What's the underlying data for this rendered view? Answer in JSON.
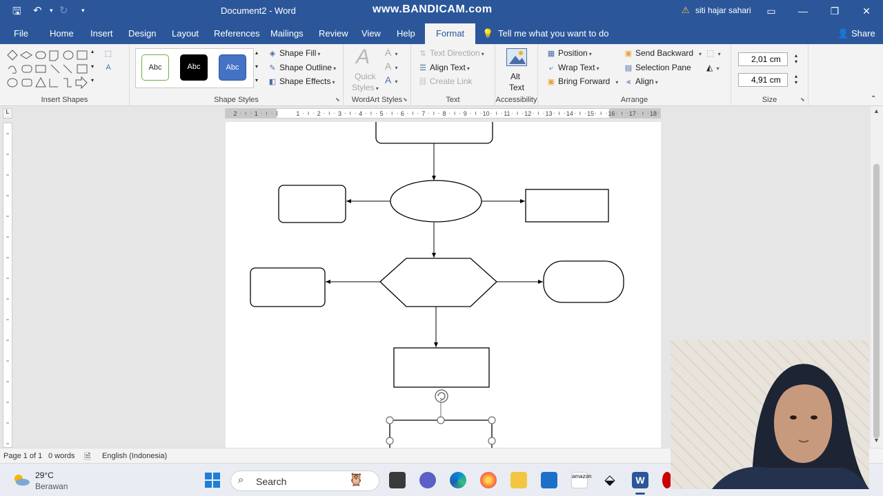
{
  "titlebar": {
    "title": "Document2 - Word",
    "watermark": "www.BANDICAM.com",
    "user": "siti hajar sahari"
  },
  "tabs": [
    "File",
    "Home",
    "Insert",
    "Design",
    "Layout",
    "References",
    "Mailings",
    "Review",
    "View",
    "Help",
    "Format"
  ],
  "active_tab": "Format",
  "tell_me": "Tell me what you want to do",
  "share": "Share",
  "ribbon": {
    "insert_shapes_label": "Insert Shapes",
    "shape_styles": {
      "swatch_text": "Abc",
      "shape_fill": "Shape Fill",
      "shape_outline": "Shape Outline",
      "shape_effects": "Shape Effects",
      "label": "Shape Styles"
    },
    "wordart": {
      "quick_styles_1": "Quick",
      "quick_styles_2": "Styles",
      "label": "WordArt Styles"
    },
    "text": {
      "text_direction": "Text Direction",
      "align_text": "Align Text",
      "create_link": "Create Link",
      "label": "Text"
    },
    "accessibility": {
      "alt_text_1": "Alt",
      "alt_text_2": "Text",
      "label": "Accessibility"
    },
    "arrange": {
      "position": "Position",
      "wrap_text": "Wrap Text",
      "bring_forward": "Bring Forward",
      "send_backward": "Send Backward",
      "selection_pane": "Selection Pane",
      "align": "Align",
      "label": "Arrange"
    },
    "size": {
      "height": "2,01 cm",
      "width": "4,91 cm",
      "label": "Size"
    }
  },
  "ruler": {
    "labels": [
      "2",
      "1",
      "1",
      "2",
      "3",
      "4",
      "5",
      "6",
      "7",
      "8",
      "9",
      "10",
      "11",
      "12",
      "13",
      "14",
      "15",
      "16",
      "17",
      "18"
    ]
  },
  "statusbar": {
    "page": "Page 1 of 1",
    "words": "0 words",
    "language": "English (Indonesia)"
  },
  "taskbar": {
    "temperature": "29°C",
    "weather": "Berawan",
    "search": "Search",
    "amazon": "amazon"
  },
  "colors": {
    "word_blue": "#2b579a",
    "ribbon_bg": "#f3f3f3",
    "shape_stroke": "#000000",
    "handle_gray": "#707070"
  }
}
